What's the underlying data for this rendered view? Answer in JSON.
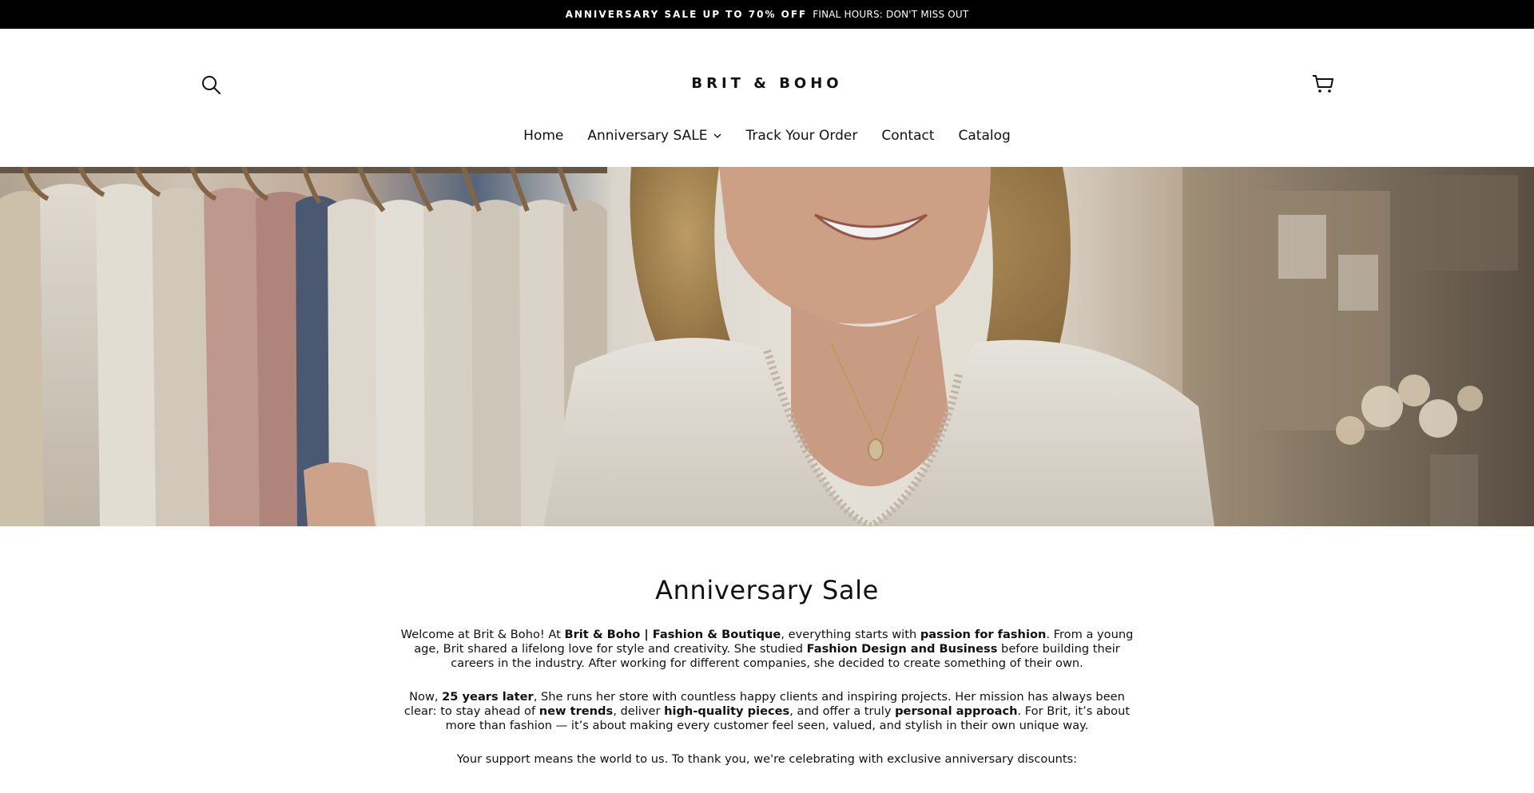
{
  "announcement": {
    "strong": "ANNIVERSARY SALE UP TO 70% OFF",
    "rest": "FINAL HOURS: DON'T MISS OUT"
  },
  "header": {
    "logo": "BRIT & BOHO",
    "search_icon": "search-icon",
    "cart_icon": "cart-icon"
  },
  "nav": {
    "items": [
      {
        "label": "Home"
      },
      {
        "label": "Anniversary SALE",
        "has_dropdown": true
      },
      {
        "label": "Track Your Order"
      },
      {
        "label": "Contact"
      },
      {
        "label": "Catalog"
      }
    ]
  },
  "hero": {
    "image_description_icon": "hero-image"
  },
  "main": {
    "title": "Anniversary Sale",
    "p1": {
      "t1": "Welcome at Brit & Boho! At ",
      "b1": "Brit & Boho | Fashion & Boutique",
      "t2": ", everything starts with ",
      "b2": "passion for fashion",
      "t3": ". From a young age, Brit shared a lifelong love for style and creativity. She studied ",
      "b3": "Fashion Design and Business",
      "t4": " before building their careers in the industry. After working for different companies, she decided to create something of their own."
    },
    "p2": {
      "t1": "Now, ",
      "b1": "25 years later",
      "t2": ", She runs her store with countless happy clients and inspiring projects. Her mission has always been clear: to stay ahead of ",
      "b2": "new trends",
      "t3": ", deliver ",
      "b3": "high-quality pieces",
      "t4": ", and offer a truly ",
      "b4": "personal approach",
      "t5": ". For Brit, it’s about more than fashion — it’s about making every customer feel seen, valued, and stylish in their own unique way."
    },
    "p3": "Your support means the world to us. To thank you, we're celebrating with exclusive anniversary discounts:"
  },
  "colors": {
    "announcement_bg": "#000000",
    "text": "#111111",
    "background": "#ffffff"
  }
}
